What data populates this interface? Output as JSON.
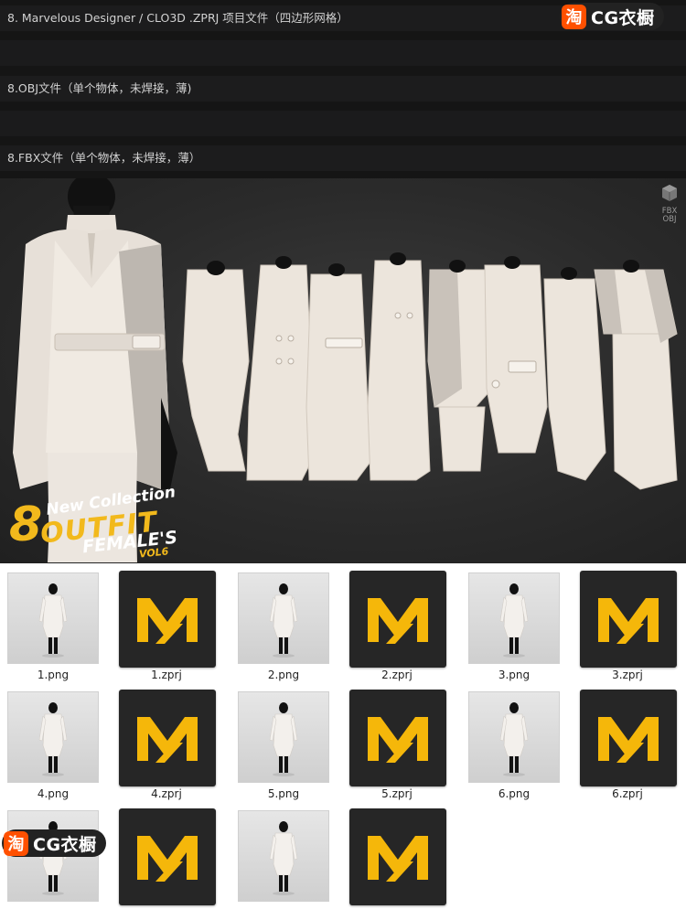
{
  "info_lines": [
    "8. Marvelous Designer / CLO3D .ZPRJ 项目文件（四边形网格）",
    "8.OBJ文件（单个物体，未焊接，薄)",
    "8.FBX文件（单个物体，未焊接，薄）"
  ],
  "watermark": {
    "badge": "淘",
    "text": "CG衣橱"
  },
  "banner": {
    "format_badge": [
      "FBX",
      "OBJ"
    ],
    "promo": {
      "new_collection": "New Collection",
      "eight": "8",
      "outfit": "OUTFIT",
      "females": "FEMALE'S",
      "vol": "VOL6"
    }
  },
  "files": [
    {
      "name": "1.png",
      "type": "png"
    },
    {
      "name": "1.zprj",
      "type": "zprj"
    },
    {
      "name": "2.png",
      "type": "png"
    },
    {
      "name": "2.zprj",
      "type": "zprj"
    },
    {
      "name": "3.png",
      "type": "png"
    },
    {
      "name": "3.zprj",
      "type": "zprj"
    },
    {
      "name": "4.png",
      "type": "png"
    },
    {
      "name": "4.zprj",
      "type": "zprj"
    },
    {
      "name": "5.png",
      "type": "png"
    },
    {
      "name": "5.zprj",
      "type": "zprj"
    },
    {
      "name": "6.png",
      "type": "png"
    },
    {
      "name": "6.zprj",
      "type": "zprj"
    },
    {
      "name": "",
      "type": "png"
    },
    {
      "name": "",
      "type": "zprj"
    },
    {
      "name": "",
      "type": "png"
    },
    {
      "name": "",
      "type": "zprj"
    }
  ],
  "colors": {
    "accent_orange": "#ff5000",
    "md_yellow": "#f5b70a",
    "dark": "#151515"
  }
}
